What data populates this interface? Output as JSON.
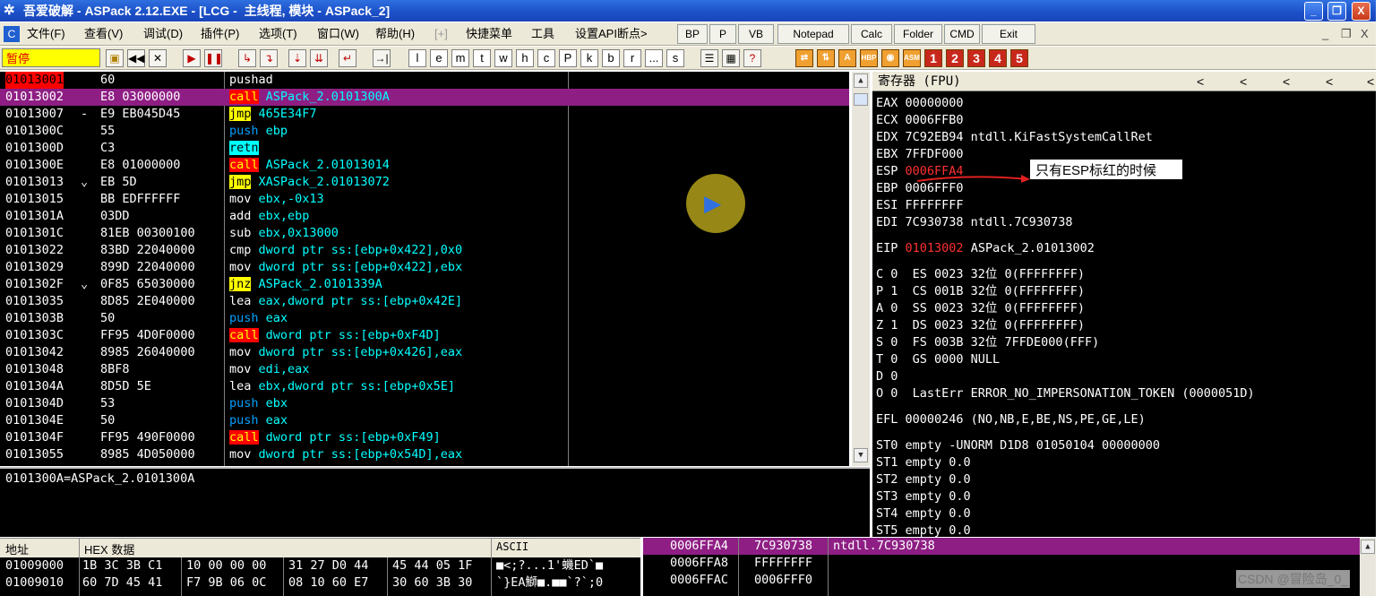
{
  "window": {
    "title": "吾爱破解 - ASPack 2.12.EXE - [LCG -  主线程, 模块 - ASPack_2]",
    "buttons": {
      "minimize": "_",
      "restore": "❐",
      "close": "X"
    },
    "inner_buttons": {
      "minimize": "_",
      "restore": "❐",
      "close": "X"
    }
  },
  "menu": {
    "items": [
      "文件(F)",
      "查看(V)",
      "调试(D)",
      "插件(P)",
      "选项(T)",
      "窗口(W)",
      "帮助(H)",
      "[+]",
      "快捷菜单",
      "工具",
      "设置API断点>"
    ],
    "buttons": [
      "BP",
      "P",
      "VB",
      "Notepad",
      "Calc",
      "Folder",
      "CMD",
      "Exit"
    ]
  },
  "toolbar": {
    "status": "暂停",
    "letters": [
      "l",
      "e",
      "m",
      "t",
      "w",
      "h",
      "c",
      "P",
      "k",
      "b",
      "r",
      "...",
      "s"
    ],
    "numbers": [
      "1",
      "2",
      "3",
      "4",
      "5"
    ]
  },
  "disasm": {
    "rows": [
      {
        "addr": "01013001",
        "mark": "",
        "hex": "60",
        "mn": "pushad",
        "ops": "",
        "cls": ""
      },
      {
        "addr": "01013002",
        "mark": "",
        "hex": "E8 03000000",
        "mn": "call",
        "ops": "ASPack_2.0101300A",
        "cls": "call"
      },
      {
        "addr": "01013007",
        "mark": "-",
        "hex": "E9 EB045D45",
        "mn": "jmp",
        "ops": "465E34F7",
        "cls": "jmp"
      },
      {
        "addr": "0101300C",
        "mark": "",
        "hex": "55",
        "mn": "push",
        "ops": "ebp",
        "cls": "push"
      },
      {
        "addr": "0101300D",
        "mark": "",
        "hex": "C3",
        "mn": "retn",
        "ops": "",
        "cls": "retn"
      },
      {
        "addr": "0101300E",
        "mark": "",
        "hex": "E8 01000000",
        "mn": "call",
        "ops": "ASPack_2.01013014",
        "cls": "call"
      },
      {
        "addr": "01013013",
        "mark": "⌄",
        "hex": "EB 5D",
        "mn": "jmp",
        "ops": "XASPack_2.01013072",
        "cls": "jmp"
      },
      {
        "addr": "01013015",
        "mark": "",
        "hex": "BB EDFFFFFF",
        "mn": "mov",
        "ops": "ebx,-0x13",
        "cls": ""
      },
      {
        "addr": "0101301A",
        "mark": "",
        "hex": "03DD",
        "mn": "add",
        "ops": "ebx,ebp",
        "cls": ""
      },
      {
        "addr": "0101301C",
        "mark": "",
        "hex": "81EB 00300100",
        "mn": "sub",
        "ops": "ebx,0x13000",
        "cls": ""
      },
      {
        "addr": "01013022",
        "mark": "",
        "hex": "83BD 22040000",
        "mn": "cmp",
        "ops": "dword ptr ss:[ebp+0x422],0x0",
        "cls": ""
      },
      {
        "addr": "01013029",
        "mark": "",
        "hex": "899D 22040000",
        "mn": "mov",
        "ops": "dword ptr ss:[ebp+0x422],ebx",
        "cls": ""
      },
      {
        "addr": "0101302F",
        "mark": "⌄",
        "hex": "0F85 65030000",
        "mn": "jnz",
        "ops": "ASPack_2.0101339A",
        "cls": "jmp"
      },
      {
        "addr": "01013035",
        "mark": "",
        "hex": "8D85 2E040000",
        "mn": "lea",
        "ops": "eax,dword ptr ss:[ebp+0x42E]",
        "cls": ""
      },
      {
        "addr": "0101303B",
        "mark": "",
        "hex": "50",
        "mn": "push",
        "ops": "eax",
        "cls": "push"
      },
      {
        "addr": "0101303C",
        "mark": "",
        "hex": "FF95 4D0F0000",
        "mn": "call",
        "ops": "dword ptr ss:[ebp+0xF4D]",
        "cls": "call"
      },
      {
        "addr": "01013042",
        "mark": "",
        "hex": "8985 26040000",
        "mn": "mov",
        "ops": "dword ptr ss:[ebp+0x426],eax",
        "cls": ""
      },
      {
        "addr": "01013048",
        "mark": "",
        "hex": "8BF8",
        "mn": "mov",
        "ops": "edi,eax",
        "cls": ""
      },
      {
        "addr": "0101304A",
        "mark": "",
        "hex": "8D5D 5E",
        "mn": "lea",
        "ops": "ebx,dword ptr ss:[ebp+0x5E]",
        "cls": ""
      },
      {
        "addr": "0101304D",
        "mark": "",
        "hex": "53",
        "mn": "push",
        "ops": "ebx",
        "cls": "push"
      },
      {
        "addr": "0101304E",
        "mark": "",
        "hex": "50",
        "mn": "push",
        "ops": "eax",
        "cls": "push"
      },
      {
        "addr": "0101304F",
        "mark": "",
        "hex": "FF95 490F0000",
        "mn": "call",
        "ops": "dword ptr ss:[ebp+0xF49]",
        "cls": "call"
      },
      {
        "addr": "01013055",
        "mark": "",
        "hex": "8985 4D050000",
        "mn": "mov",
        "ops": "dword ptr ss:[ebp+0x54D],eax",
        "cls": ""
      }
    ],
    "info": "0101300A=ASPack_2.0101300A"
  },
  "registers": {
    "title": "寄存器 (FPU)",
    "arrows": [
      "<",
      "<",
      "<",
      "<",
      "<"
    ],
    "lines": [
      "EAX 00000000",
      "ECX 0006FFB0",
      "EDX 7C92EB94 ntdll.KiFastSystemCallRet",
      "EBX 7FFDF000",
      "",
      "EBP 0006FFF0",
      "ESI FFFFFFFF",
      "EDI 7C930738 ntdll.7C930738"
    ],
    "esp_label": "ESP",
    "esp_value": "0006FFA4",
    "eip_label": "EIP",
    "eip_value": "01013002",
    "eip_desc": "ASPack_2.01013002",
    "flags": [
      "C 0  ES 0023 32位 0(FFFFFFFF)",
      "P 1  CS 001B 32位 0(FFFFFFFF)",
      "A 0  SS 0023 32位 0(FFFFFFFF)",
      "Z 1  DS 0023 32位 0(FFFFFFFF)",
      "S 0  FS 003B 32位 7FFDE000(FFF)",
      "T 0  GS 0000 NULL",
      "D 0",
      "O 0  LastErr ERROR_NO_IMPERSONATION_TOKEN (0000051D)"
    ],
    "efl": "EFL 00000246 (NO,NB,E,BE,NS,PE,GE,LE)",
    "fpu": [
      "ST0 empty -UNORM D1D8 01050104 00000000",
      "ST1 empty 0.0",
      "ST2 empty 0.0",
      "ST3 empty 0.0",
      "ST4 empty 0.0",
      "ST5 empty 0.0"
    ],
    "annotation": "只有ESP标红的时候"
  },
  "dump": {
    "headers": {
      "addr": "地址",
      "hex": "HEX 数据",
      "ascii": "ASCII"
    },
    "rows": [
      {
        "addr": "01009000",
        "b1": "1B 3C 3B C1",
        "b2": "10 00 00 00",
        "b3": "31 27 D0 44",
        "b4": "45 44 05 1F",
        "ascii": "■<;?...1'蟣ED`■"
      },
      {
        "addr": "01009010",
        "b1": "60 7D 45 41",
        "b2": "F7 9B 06 0C",
        "b3": "08 10 60 E7",
        "b4": "30 60 3B 30",
        "ascii": "`}EA鰤■.■■`?`;0"
      }
    ]
  },
  "stack": {
    "rows": [
      {
        "addr": "0006FFA4",
        "val": "7C930738",
        "desc": "ntdll.7C930738"
      },
      {
        "addr": "0006FFA8",
        "val": "FFFFFFFF",
        "desc": ""
      },
      {
        "addr": "0006FFAC",
        "val": "0006FFF0",
        "desc": ""
      }
    ]
  },
  "watermark": "CSDN @冒险岛_0_",
  "colors": {
    "highlight": "#8e1e84",
    "esp_red": "#ff0000",
    "titlebar": "#1b4fc7"
  }
}
